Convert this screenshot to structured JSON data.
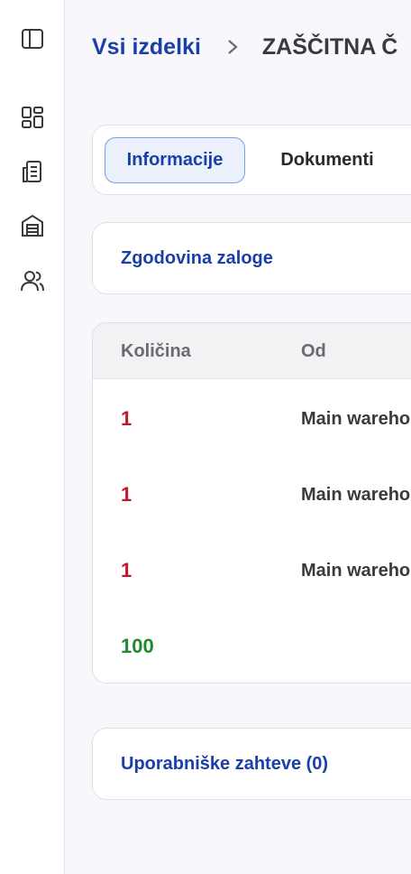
{
  "breadcrumb": {
    "parent": "Vsi izdelki",
    "current": "ZAŠČITNA Č"
  },
  "sidebar": {
    "items": [
      {
        "icon": "sidebar-toggle-icon"
      },
      {
        "icon": "dashboard-icon"
      },
      {
        "icon": "documents-icon"
      },
      {
        "icon": "warehouse-icon"
      },
      {
        "icon": "users-icon"
      }
    ]
  },
  "tabs": [
    {
      "label": "Informacije",
      "active": true
    },
    {
      "label": "Dokumenti",
      "active": false
    }
  ],
  "stock_history": {
    "title": "Zgodovina zaloge",
    "columns": [
      "Količina",
      "Od"
    ],
    "rows": [
      {
        "qty": "1",
        "from": "Main wareho",
        "type": "negative"
      },
      {
        "qty": "1",
        "from": "Main wareho",
        "type": "negative"
      },
      {
        "qty": "1",
        "from": "Main wareho",
        "type": "negative"
      },
      {
        "qty": "100",
        "from": "",
        "type": "positive"
      }
    ]
  },
  "user_requests": {
    "title": "Uporabniške zahteve (0)"
  },
  "colors": {
    "accent": "#1a3fa8",
    "negative": "#c0192c",
    "positive": "#1d8a2c"
  }
}
